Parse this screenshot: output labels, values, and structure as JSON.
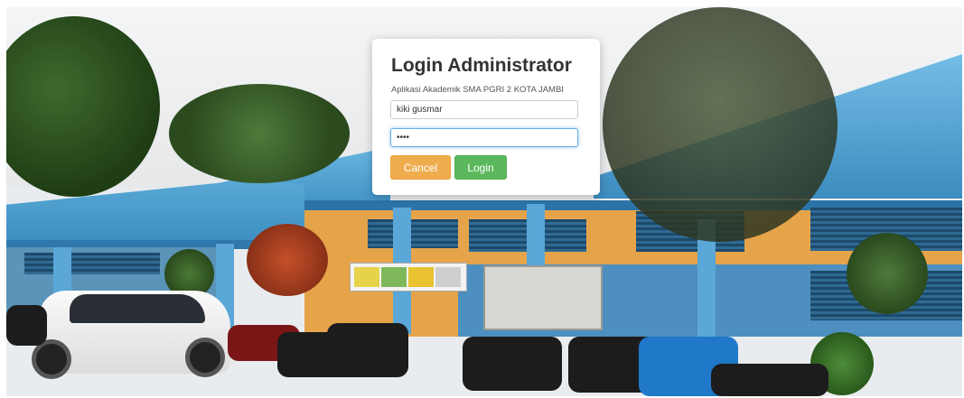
{
  "login_dialog": {
    "title": "Login Administrator",
    "subtitle": "Aplikasi Akademik SMA PGRI 2 KOTA JAMBI",
    "username_value": "kiki gusmar",
    "password_value": "••••",
    "cancel_label": "Cancel",
    "login_label": "Login"
  },
  "colors": {
    "cancel_button": "#f0ad4e",
    "login_button": "#5cb85c",
    "focus_border": "#66afe9"
  },
  "background": {
    "description_icon": "school-building-photo"
  }
}
